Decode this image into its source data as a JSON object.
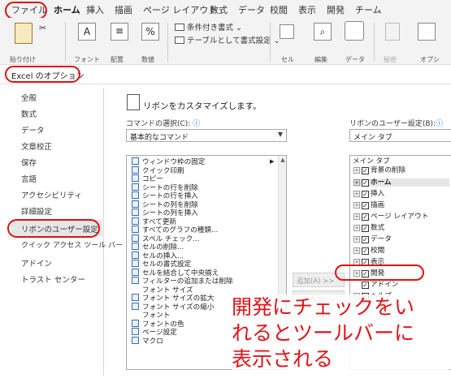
{
  "menubar": {
    "tabs": [
      "ファイル",
      "ホーム",
      "挿入",
      "描画",
      "ページ レイアウト",
      "数式",
      "データ",
      "校閲",
      "表示",
      "開発",
      "チーム"
    ],
    "active_tab": "ホーム"
  },
  "ribbon": {
    "paste_label": "貼り付け",
    "font_label": "フォント",
    "alignment_label": "配置",
    "number_label": "数値",
    "conditional_format_label": "条件付き書式 ⌄",
    "table_format_label": "テーブルとして書式設定 ⌄",
    "cells_label": "セル",
    "editing_label": "編集",
    "data_label": "データ",
    "sensitivity_label": "秘密",
    "option_label": "オプシ"
  },
  "options_window": {
    "title": "Excel のオプション"
  },
  "sidebar": {
    "items": [
      "全般",
      "数式",
      "データ",
      "文章校正",
      "保存",
      "言語",
      "アクセシビリティ",
      "詳細設定",
      "リボンのユーザー設定",
      "クイック アクセス ツール バー",
      "アドイン",
      "トラスト センター"
    ],
    "selected": "リボンのユーザー設定"
  },
  "main": {
    "heading": "リボンをカスタマイズします。",
    "choose_commands_label": "コマンドの選択(C):",
    "choose_commands_value": "基本的なコマンド",
    "customize_ribbon_label": "リボンのユーザー設定(B):",
    "customize_ribbon_value": "メイン タブ",
    "info_icon": "ⓘ"
  },
  "commands": [
    "ウィンドウ枠の固定",
    "クイック印刷",
    "コピー",
    "シートの行を削除",
    "シートの行を挿入",
    "シートの列を削除",
    "シートの列を挿入",
    "すべて更新",
    "すべてのグラフの種類...",
    "スペル チェック...",
    "セルの削除...",
    "セルの挿入...",
    "セルの書式設定",
    "セルを結合して中央揃え",
    "フィルターの追加または削除",
    "フォント サイズ",
    "フォント サイズの拡大",
    "フォント サイズの縮小",
    "フォント",
    "フォントの色",
    "ページ設定",
    "マクロ"
  ],
  "mid_buttons": {
    "add": "追加(A) >>",
    "remove": "<< 削除(R)"
  },
  "tabs_tree": {
    "header": "メイン タブ",
    "items": [
      {
        "label": "背景の削除",
        "checked": true,
        "bold": false
      },
      {
        "label": "ホーム",
        "checked": true,
        "bold": true
      },
      {
        "label": "挿入",
        "checked": true,
        "bold": false
      },
      {
        "label": "描画",
        "checked": true,
        "bold": false
      },
      {
        "label": "ページ レイアウト",
        "checked": true,
        "bold": false
      },
      {
        "label": "数式",
        "checked": true,
        "bold": false
      },
      {
        "label": "データ",
        "checked": true,
        "bold": false
      },
      {
        "label": "校閲",
        "checked": true,
        "bold": false
      },
      {
        "label": "表示",
        "checked": true,
        "bold": false
      },
      {
        "label": "開発",
        "checked": true,
        "bold": false
      },
      {
        "label": "アドイン",
        "checked": true,
        "bold": false
      },
      {
        "label": "ヘルプ",
        "checked": true,
        "bold": false
      }
    ]
  },
  "annotation": {
    "lines": [
      "開発にチェックをい",
      "れるとツールバーに",
      "表示される"
    ]
  },
  "colors": {
    "highlight_red": "#e01010",
    "excel_green": "#217346"
  }
}
